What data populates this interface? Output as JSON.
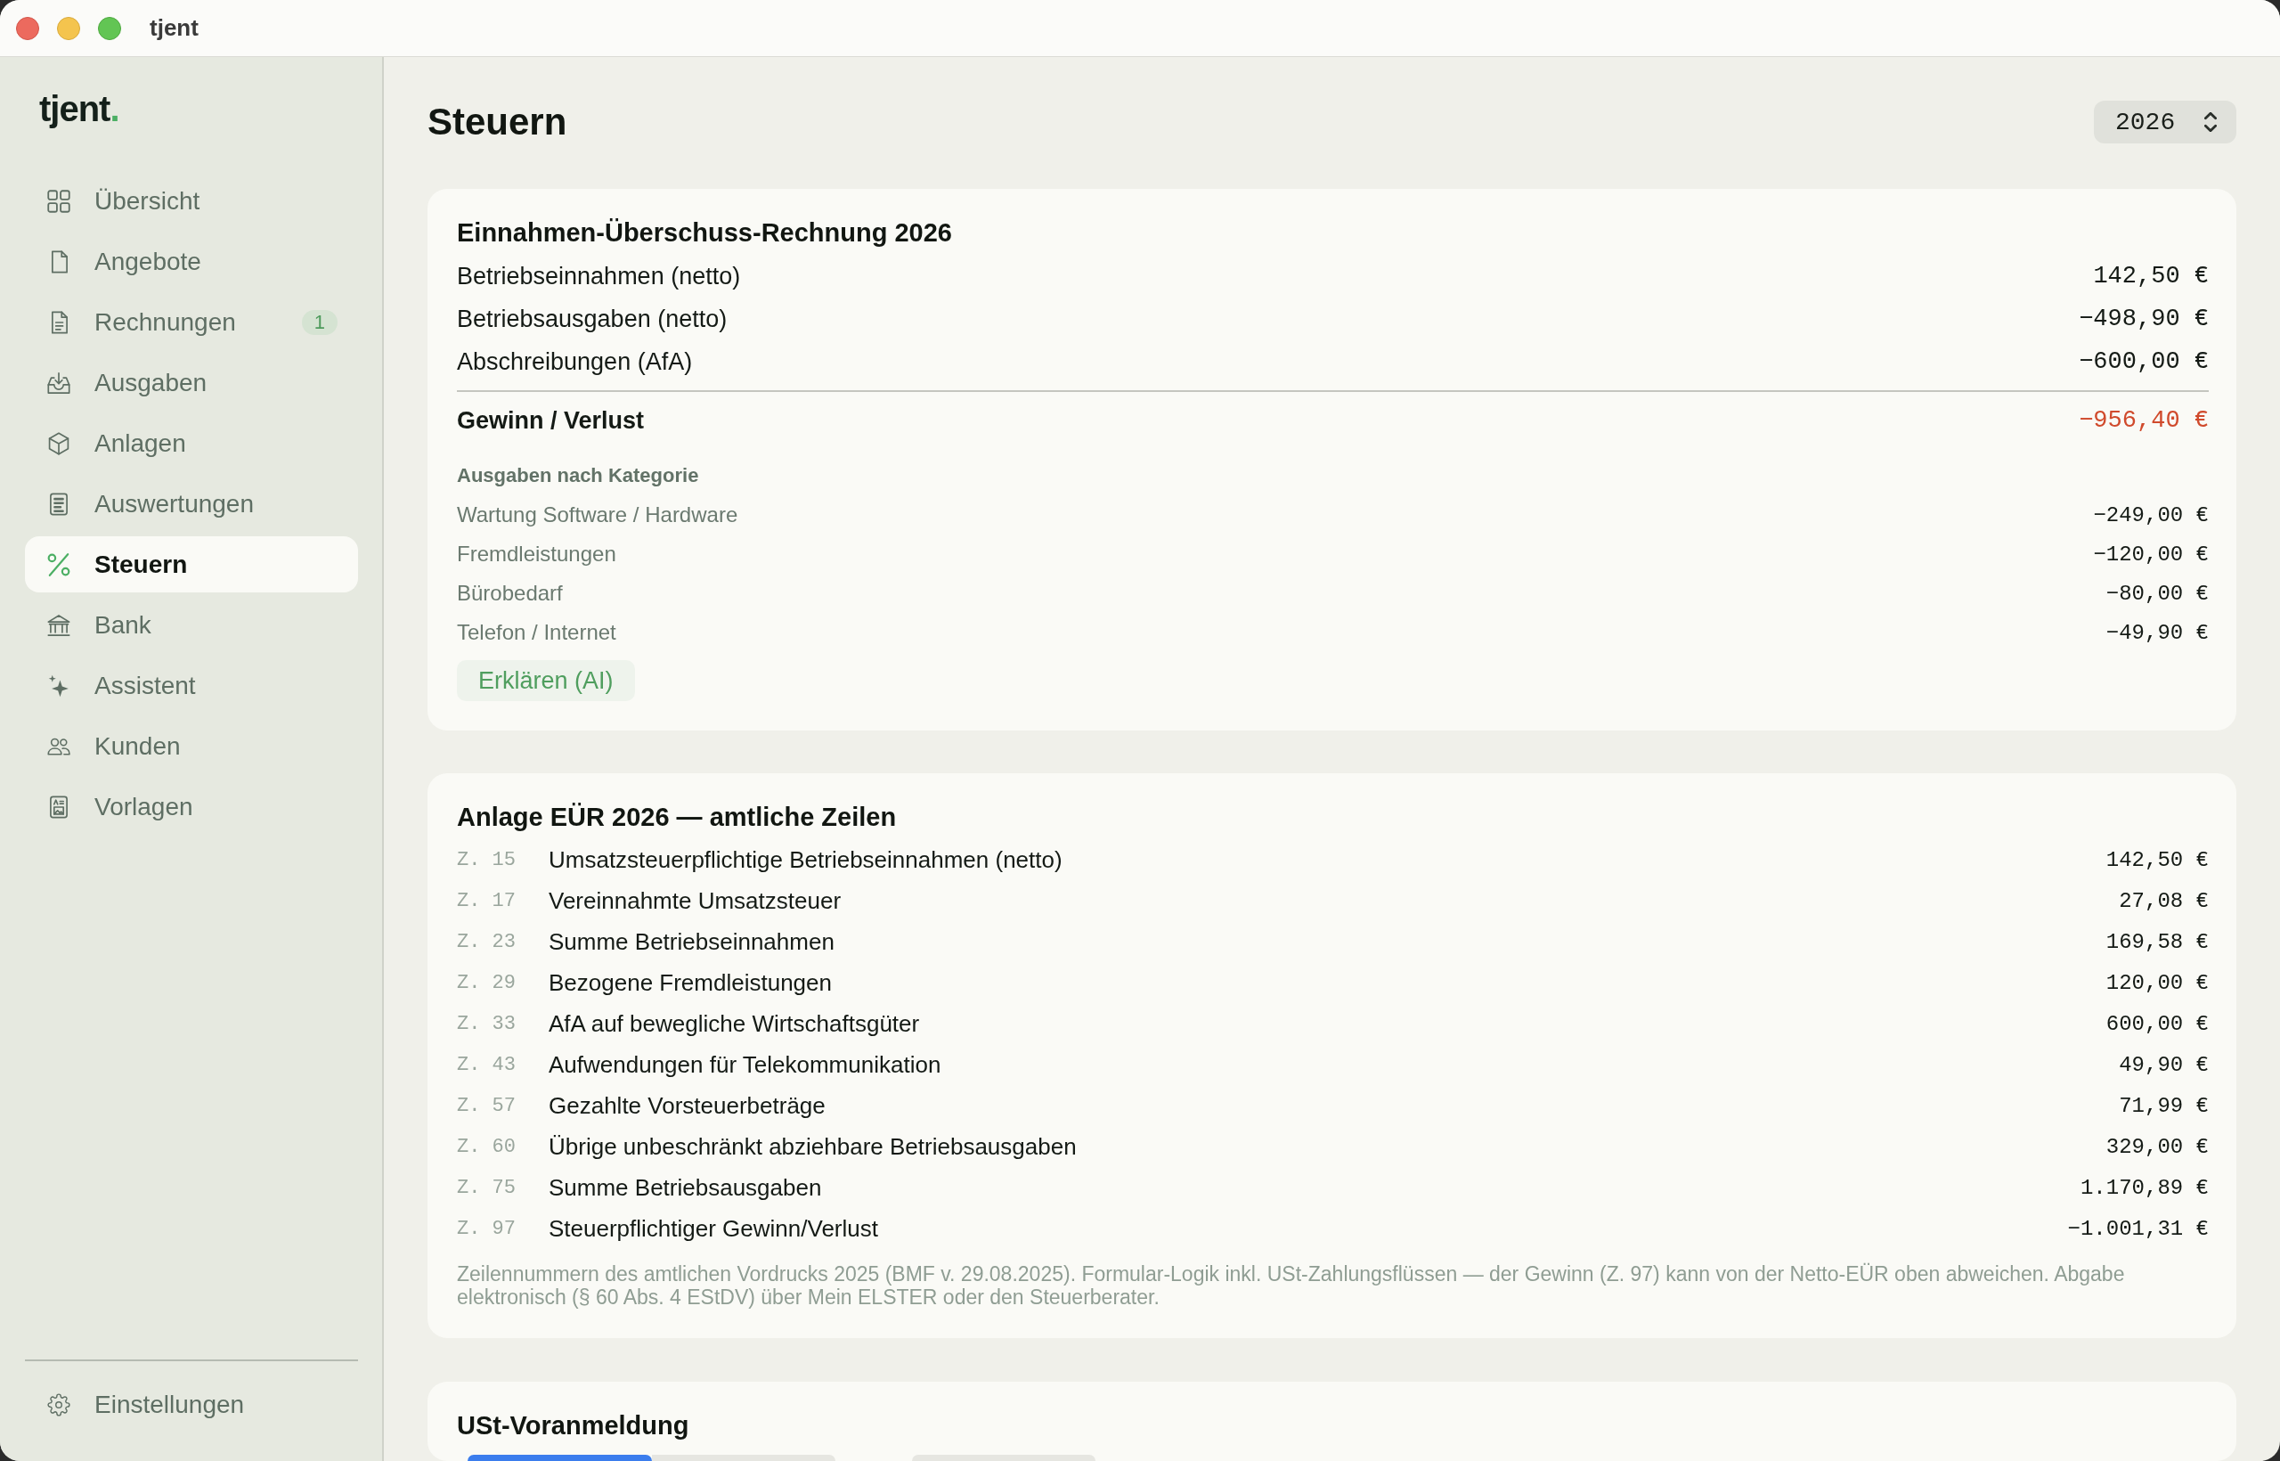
{
  "window": {
    "title": "tjent"
  },
  "sidebar": {
    "logo": {
      "name": "tjent",
      "dot": "."
    },
    "items": [
      {
        "label": "Übersicht",
        "selected": false
      },
      {
        "label": "Angebote",
        "selected": false
      },
      {
        "label": "Rechnungen",
        "selected": false,
        "badge": "1"
      },
      {
        "label": "Ausgaben",
        "selected": false
      },
      {
        "label": "Anlagen",
        "selected": false
      },
      {
        "label": "Auswertungen",
        "selected": false
      },
      {
        "label": "Steuern",
        "selected": true
      },
      {
        "label": "Bank",
        "selected": false
      },
      {
        "label": "Assistent",
        "selected": false
      },
      {
        "label": "Kunden",
        "selected": false
      },
      {
        "label": "Vorlagen",
        "selected": false
      }
    ],
    "footer_item": {
      "label": "Einstellungen"
    }
  },
  "header": {
    "title": "Steuern",
    "year_select": {
      "value": "2026"
    }
  },
  "eur_card": {
    "title": "Einnahmen-Überschuss-Rechnung 2026",
    "rows": [
      {
        "kind": "line",
        "label": "Betriebseinnahmen (netto)",
        "value": "142,50 €"
      },
      {
        "kind": "line",
        "label": "Betriebsausgaben (netto)",
        "value": "−498,90 €"
      },
      {
        "kind": "line",
        "label": "Abschreibungen (AfA)",
        "value": "−600,00 €"
      },
      {
        "kind": "total",
        "label": "Gewinn / Verlust",
        "value": "−956,40 €"
      }
    ],
    "category_heading": "Ausgaben nach Kategorie",
    "categories": [
      {
        "label": "Wartung Software / Hardware",
        "value": "−249,00 €"
      },
      {
        "label": "Fremdleistungen",
        "value": "−120,00 €"
      },
      {
        "label": "Bürobedarf",
        "value": "−80,00 €"
      },
      {
        "label": "Telefon / Internet",
        "value": "−49,90 €"
      }
    ],
    "button": "Erklären (AI)"
  },
  "anlage_card": {
    "title": "Anlage EÜR 2026 — amtliche Zeilen",
    "rows": [
      {
        "line": "Z. 15",
        "label": "Umsatzsteuerpflichtige Betriebseinnahmen (netto)",
        "value": "142,50 €"
      },
      {
        "line": "Z. 17",
        "label": "Vereinnahmte Umsatzsteuer",
        "value": "27,08 €"
      },
      {
        "line": "Z. 23",
        "label": "Summe Betriebseinnahmen",
        "value": "169,58 €"
      },
      {
        "line": "Z. 29",
        "label": "Bezogene Fremdleistungen",
        "value": "120,00 €"
      },
      {
        "line": "Z. 33",
        "label": "AfA auf bewegliche Wirtschaftsgüter",
        "value": "600,00 €"
      },
      {
        "line": "Z. 43",
        "label": "Aufwendungen für Telekommunikation",
        "value": "49,90 €"
      },
      {
        "line": "Z. 57",
        "label": "Gezahlte Vorsteuerbeträge",
        "value": "71,99 €"
      },
      {
        "line": "Z. 60",
        "label": "Übrige unbeschränkt abziehbare Betriebsausgaben",
        "value": "329,00 €"
      },
      {
        "line": "Z. 75",
        "label": "Summe Betriebsausgaben",
        "value": "1.170,89 €"
      },
      {
        "line": "Z. 97",
        "label": "Steuerpflichtiger Gewinn/Verlust",
        "value": "−1.001,31 €"
      }
    ],
    "footnote": "Zeilennummern des amtlichen Vordrucks 2025 (BMF v. 29.08.2025). Formular-Logik inkl. USt-Zahlungsflüssen — der Gewinn (Z. 97) kann von der Netto-EÜR oben abweichen. Abgabe elektronisch (§ 60 Abs. 4 EStDV) über Mein ELSTER oder den Steuerberater."
  },
  "ust_card": {
    "title": "USt-Voranmeldung",
    "segments": [
      {
        "selected": true
      },
      {
        "selected": false
      }
    ]
  }
}
